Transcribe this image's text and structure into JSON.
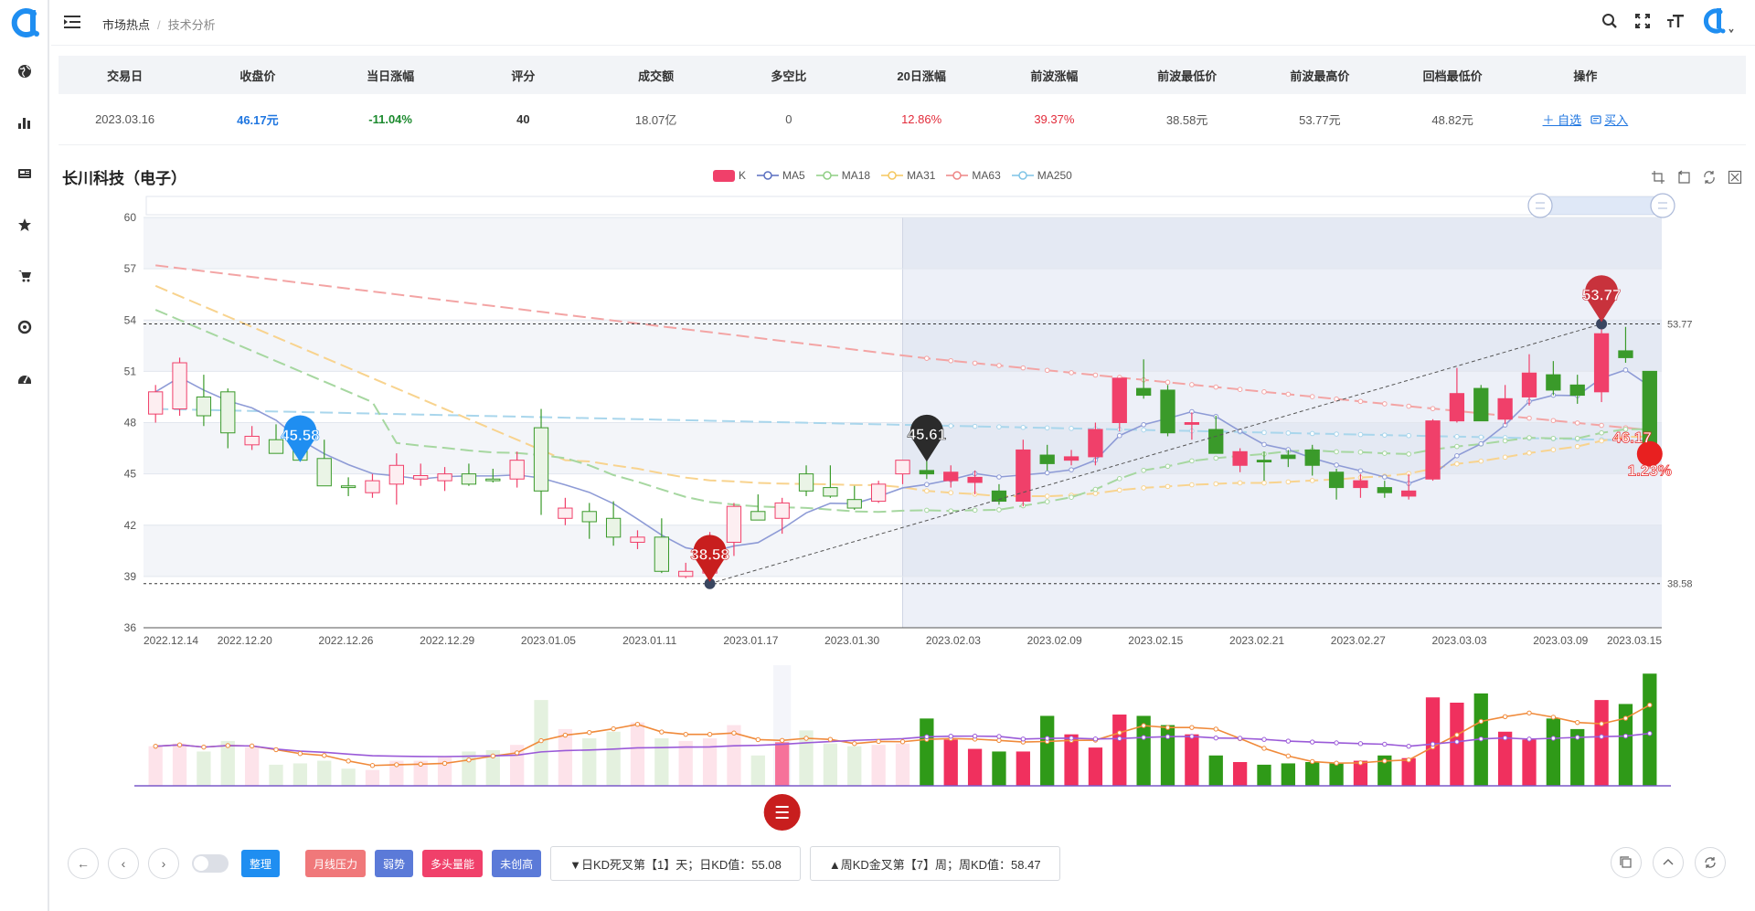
{
  "header": {
    "breadcrumb": [
      "市场热点",
      "技术分析"
    ]
  },
  "table": {
    "headers": [
      "交易日",
      "收盘价",
      "当日涨幅",
      "评分",
      "成交额",
      "多空比",
      "20日涨幅",
      "前波涨幅",
      "前波最低价",
      "前波最高价",
      "回档最低价",
      "操作"
    ],
    "row": {
      "date": "2023.03.16",
      "close": "46.17元",
      "change": "-11.04%",
      "score": "40",
      "amount": "18.07亿",
      "ratio": "0",
      "chg20": "12.86%",
      "wave_chg": "39.37%",
      "wave_low": "38.58元",
      "wave_high": "53.77元",
      "pullback_low": "48.82元"
    },
    "ops": [
      "＋ 自选",
      "买入"
    ]
  },
  "stock_title": "长川科技（电子）",
  "legend": [
    "K",
    "MA5",
    "MA18",
    "MA31",
    "MA63",
    "MA250"
  ],
  "colors": {
    "up": "#f0406a",
    "down": "#3a9a2a",
    "ma5": "#8e9bd6",
    "ma18": "#a6d7a0",
    "ma31": "#f8d38e",
    "ma63": "#f3a4a4",
    "ma250": "#a9d6ec"
  },
  "chart_data": {
    "type": "candlestick",
    "y_axis": {
      "ticks": [
        36,
        39,
        42,
        45,
        48,
        51,
        54,
        57,
        60
      ],
      "ylim": [
        36,
        60
      ]
    },
    "x_tick_labels": [
      "2022.12.14",
      "2022.12.20",
      "2022.12.26",
      "2022.12.29",
      "2023.01.05",
      "2023.01.11",
      "2023.01.17",
      "2023.01.30",
      "2023.02.03",
      "2023.02.09",
      "2023.02.15",
      "2023.02.21",
      "2023.02.27",
      "2023.03.03",
      "2023.03.09",
      "2023.03.15"
    ],
    "ohlc": [
      [
        48.5,
        50.2,
        48.0,
        49.8
      ],
      [
        48.8,
        51.8,
        48.4,
        51.5
      ],
      [
        49.5,
        50.8,
        47.8,
        48.4
      ],
      [
        49.8,
        50.0,
        46.5,
        47.4
      ],
      [
        46.7,
        47.8,
        46.4,
        47.2
      ],
      [
        47.0,
        47.9,
        46.3,
        46.2
      ],
      [
        46.6,
        48.4,
        45.8,
        45.8
      ],
      [
        45.9,
        47.0,
        44.6,
        44.3
      ],
      [
        44.3,
        44.8,
        43.7,
        44.2
      ],
      [
        43.9,
        45.0,
        43.6,
        44.6
      ],
      [
        44.4,
        46.2,
        43.2,
        45.5
      ],
      [
        44.7,
        45.6,
        44.3,
        44.9
      ],
      [
        44.6,
        45.4,
        44.0,
        45.0
      ],
      [
        45.0,
        45.6,
        44.3,
        44.4
      ],
      [
        44.7,
        45.3,
        44.5,
        44.6
      ],
      [
        44.7,
        46.3,
        44.2,
        45.8
      ],
      [
        47.7,
        48.8,
        42.6,
        44.0
      ],
      [
        42.4,
        43.6,
        42.0,
        43.0
      ],
      [
        42.8,
        43.3,
        41.2,
        42.2
      ],
      [
        42.4,
        43.4,
        40.8,
        41.3
      ],
      [
        41.0,
        41.7,
        40.6,
        41.3
      ],
      [
        41.3,
        42.4,
        39.2,
        39.3
      ],
      [
        39.0,
        39.8,
        38.9,
        39.3
      ],
      [
        39.2,
        41.6,
        38.58,
        40.9
      ],
      [
        41.0,
        43.3,
        40.2,
        43.1
      ],
      [
        42.8,
        43.8,
        42.6,
        42.3
      ],
      [
        42.4,
        43.6,
        41.5,
        43.3
      ],
      [
        45.0,
        45.5,
        43.7,
        44.0
      ],
      [
        44.2,
        45.5,
        43.6,
        43.7
      ],
      [
        43.5,
        44.3,
        42.9,
        43.0
      ],
      [
        43.4,
        44.6,
        43.3,
        44.4
      ],
      [
        45.0,
        45.8,
        44.4,
        45.8
      ],
      [
        45.2,
        45.8,
        44.7,
        45.0
      ],
      [
        44.6,
        45.5,
        44.2,
        45.1
      ],
      [
        44.5,
        45.2,
        43.8,
        44.8
      ],
      [
        44.0,
        44.4,
        43.2,
        43.4
      ],
      [
        43.4,
        47.0,
        43.1,
        46.4
      ],
      [
        46.1,
        46.7,
        45.2,
        45.6
      ],
      [
        45.8,
        46.4,
        45.5,
        46.0
      ],
      [
        46.0,
        48.0,
        45.5,
        47.6
      ],
      [
        48.0,
        50.6,
        47.5,
        50.6
      ],
      [
        50.0,
        51.7,
        49.4,
        49.6
      ],
      [
        49.9,
        50.2,
        47.2,
        47.4
      ],
      [
        47.9,
        48.6,
        47.0,
        48.0
      ],
      [
        47.6,
        48.4,
        46.2,
        46.2
      ],
      [
        45.5,
        46.5,
        45.1,
        46.3
      ],
      [
        45.8,
        46.3,
        44.6,
        45.7
      ],
      [
        46.1,
        46.4,
        45.4,
        45.9
      ],
      [
        46.4,
        46.7,
        44.9,
        45.5
      ],
      [
        45.1,
        45.3,
        43.5,
        44.2
      ],
      [
        44.2,
        45.0,
        43.6,
        44.6
      ],
      [
        44.2,
        44.6,
        43.6,
        43.9
      ],
      [
        43.7,
        45.0,
        43.5,
        44.0
      ],
      [
        44.7,
        48.2,
        44.6,
        48.1
      ],
      [
        48.1,
        51.2,
        48.0,
        49.7
      ],
      [
        50.0,
        50.2,
        48.1,
        48.1
      ],
      [
        48.2,
        50.2,
        47.9,
        49.4
      ],
      [
        49.5,
        52.0,
        49.0,
        50.9
      ],
      [
        50.8,
        51.6,
        49.6,
        49.9
      ],
      [
        50.2,
        50.8,
        49.1,
        49.6
      ],
      [
        49.8,
        53.77,
        49.2,
        53.2
      ],
      [
        52.2,
        53.6,
        51.5,
        51.8
      ],
      [
        51.0,
        51.0,
        45.8,
        46.17
      ]
    ],
    "volume": [
      3.0,
      3.2,
      2.6,
      3.4,
      2.9,
      1.6,
      1.7,
      1.9,
      1.3,
      1.2,
      1.9,
      1.9,
      2.2,
      2.6,
      2.7,
      3.1,
      6.5,
      4.3,
      3.6,
      4.1,
      4.8,
      3.6,
      3.4,
      3.6,
      4.6,
      2.3,
      3.3,
      4.2,
      3.2,
      3.0,
      3.1,
      3.2,
      5.1,
      3.5,
      2.8,
      2.6,
      2.6,
      5.3,
      3.9,
      2.9,
      5.4,
      5.3,
      4.6,
      3.9,
      2.3,
      1.8,
      1.6,
      1.7,
      1.8,
      1.7,
      1.9,
      2.3,
      2.1,
      6.7,
      6.3,
      7.0,
      4.1,
      3.5,
      5.1,
      4.3,
      6.5,
      6.2,
      8.5
    ],
    "annotations": [
      {
        "label": "45.58",
        "index": 6,
        "value": 45.58
      },
      {
        "label": "38.58",
        "index": 23,
        "value": 38.58
      },
      {
        "label": "45.61",
        "index": 32,
        "value": 45.61
      },
      {
        "label": "53.77",
        "index": 60,
        "value": 53.77
      },
      {
        "label": "46.17",
        "index": 62,
        "value": 46.17
      },
      {
        "label": "1.23%",
        "index": 62,
        "value": 46.17
      }
    ],
    "horizontal_lines": [
      {
        "label": "53.77",
        "value": 53.77
      },
      {
        "label": "38.58",
        "value": 38.58
      }
    ]
  },
  "toolbar": {
    "tags": [
      {
        "label": "整理",
        "color": "#1f8ef1"
      },
      {
        "label": "月线压力",
        "color": "#f0787a"
      },
      {
        "label": "弱势",
        "color": "#5b7ad8"
      },
      {
        "label": "多头量能",
        "color": "#f0406a"
      },
      {
        "label": "未创高",
        "color": "#5b7ad8"
      }
    ],
    "info1": "▼日KD死叉第【1】天；日KD值：55.08",
    "info2": "▲周KD金叉第【7】周；周KD值：58.47"
  }
}
